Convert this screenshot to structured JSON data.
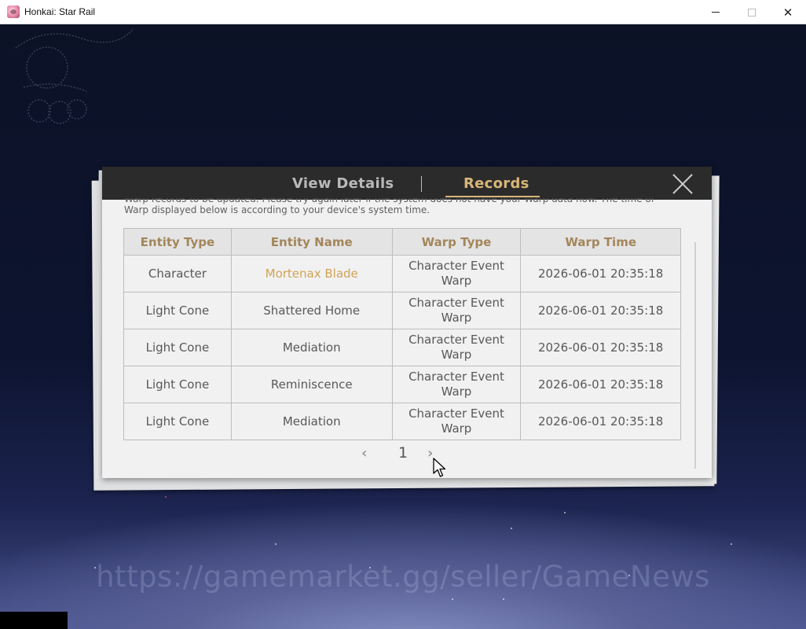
{
  "window": {
    "title": "Honkai: Star Rail",
    "minimize_glyph": "",
    "maximize_glyph": "",
    "close_glyph": "✕"
  },
  "tabs": {
    "view_details": "View Details",
    "records": "Records",
    "active": "Records"
  },
  "notice": {
    "line1": "Warp records to be updated. Please try again later if the system does not have your Warp data now. The time of",
    "line2": "Warp displayed below is according to your device's system time."
  },
  "table": {
    "headers": [
      "Entity Type",
      "Entity Name",
      "Warp Type",
      "Warp Time"
    ],
    "rows": [
      {
        "entity_type": "Character",
        "entity_name": "Mortenax Blade",
        "warp_type_1": "Character Event",
        "warp_type_2": "Warp",
        "warp_time": "2026-06-01 20:35:18"
      },
      {
        "entity_type": "Light Cone",
        "entity_name": "Shattered Home",
        "warp_type_1": "Character Event",
        "warp_type_2": "Warp",
        "warp_time": "2026-06-01 20:35:18"
      },
      {
        "entity_type": "Light Cone",
        "entity_name": "Mediation",
        "warp_type_1": "Character Event",
        "warp_type_2": "Warp",
        "warp_time": "2026-06-01 20:35:18"
      },
      {
        "entity_type": "Light Cone",
        "entity_name": "Reminiscence",
        "warp_type_1": "Character Event",
        "warp_type_2": "Warp",
        "warp_time": "2026-06-01 20:35:18"
      },
      {
        "entity_type": "Light Cone",
        "entity_name": "Mediation",
        "warp_type_1": "Character Event",
        "warp_type_2": "Warp",
        "warp_time": "2026-06-01 20:35:18"
      }
    ],
    "highlight_color": "#d2a354"
  },
  "pagination": {
    "prev_glyph": "‹",
    "current_page": "1",
    "next_glyph": "›"
  },
  "watermark": "https://gamemarket.gg/seller/GameNews",
  "colors": {
    "accent_gold": "#d9b678",
    "header_bar": "#2b2b2b",
    "panel": "#f1f1f1"
  }
}
